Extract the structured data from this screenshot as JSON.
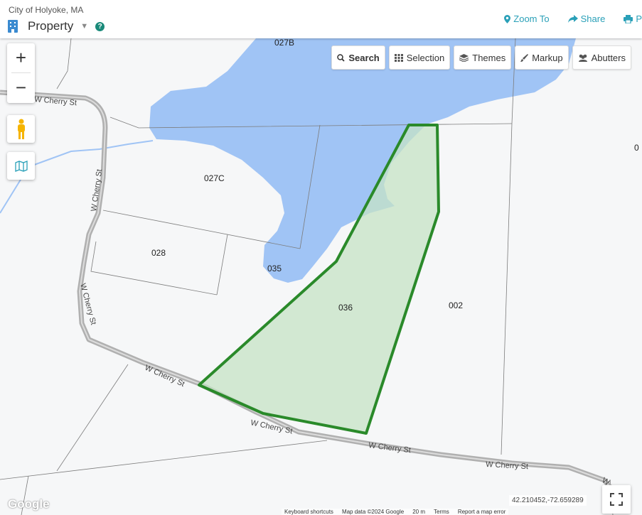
{
  "header": {
    "city": "City of Holyoke, MA",
    "layer_name": "Property",
    "help": "?",
    "actions": [
      {
        "label": "Zoom To",
        "icon": "map-marker-icon"
      },
      {
        "label": "Share",
        "icon": "share-icon"
      },
      {
        "label": "P",
        "icon": "print-icon"
      }
    ]
  },
  "toolbar": {
    "search": "Search",
    "selection": "Selection",
    "themes": "Themes",
    "markup": "Markup",
    "abutters": "Abutters"
  },
  "map": {
    "parcels": [
      "027B",
      "027C",
      "028",
      "035",
      "036",
      "002",
      "0"
    ],
    "streets": [
      "W Cherry St",
      "W Cherry St",
      "W Cherry St",
      "W Cherry St",
      "W Cherry St",
      "W Cherry St",
      "W"
    ],
    "coordinates": "42.210452,-72.659289",
    "attribution": [
      "Keyboard shortcuts",
      "Map data ©2024 Google",
      "20 m",
      "Terms",
      "Report a map error"
    ],
    "provider": "Google",
    "colors": {
      "water": "#a0c4f5",
      "selection_stroke": "#2a8a2a",
      "selection_fill": "#c6e3c6",
      "road": "#b5b5b5",
      "accent": "#2aa0b8"
    }
  }
}
